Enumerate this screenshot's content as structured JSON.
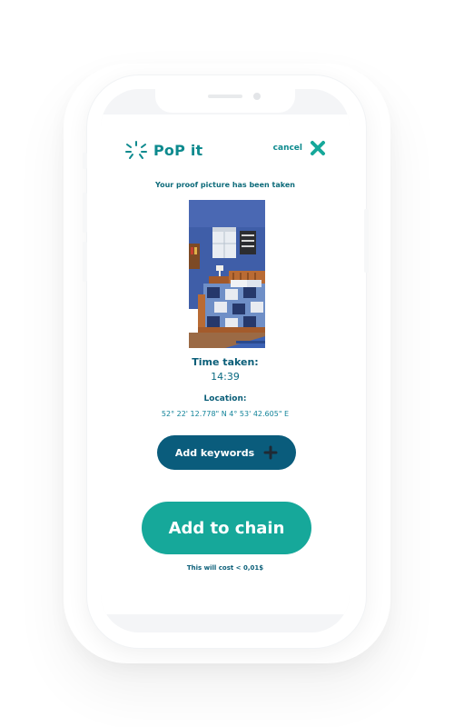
{
  "app": {
    "name": "PoP it",
    "logo_icon": "sparkle-burst-icon"
  },
  "header": {
    "cancel_label": "cancel",
    "cancel_icon": "close-icon"
  },
  "status": {
    "message": "Your proof picture has been taken"
  },
  "photo": {
    "subject": "bedroom-photo"
  },
  "details": {
    "time_label": "Time taken:",
    "time_value": "14:39",
    "location_label": "Location:",
    "location_value": "52° 22' 12.778\" N 4° 53' 42.605\" E"
  },
  "actions": {
    "add_keywords_label": "Add keywords",
    "add_keywords_icon": "plus-icon",
    "add_to_chain_label": "Add to chain",
    "cost_note": "This will cost < 0,01$"
  },
  "colors": {
    "brand_teal": "#0d8a8e",
    "dark_blue": "#0a5c7c",
    "button_green": "#16a89a"
  }
}
